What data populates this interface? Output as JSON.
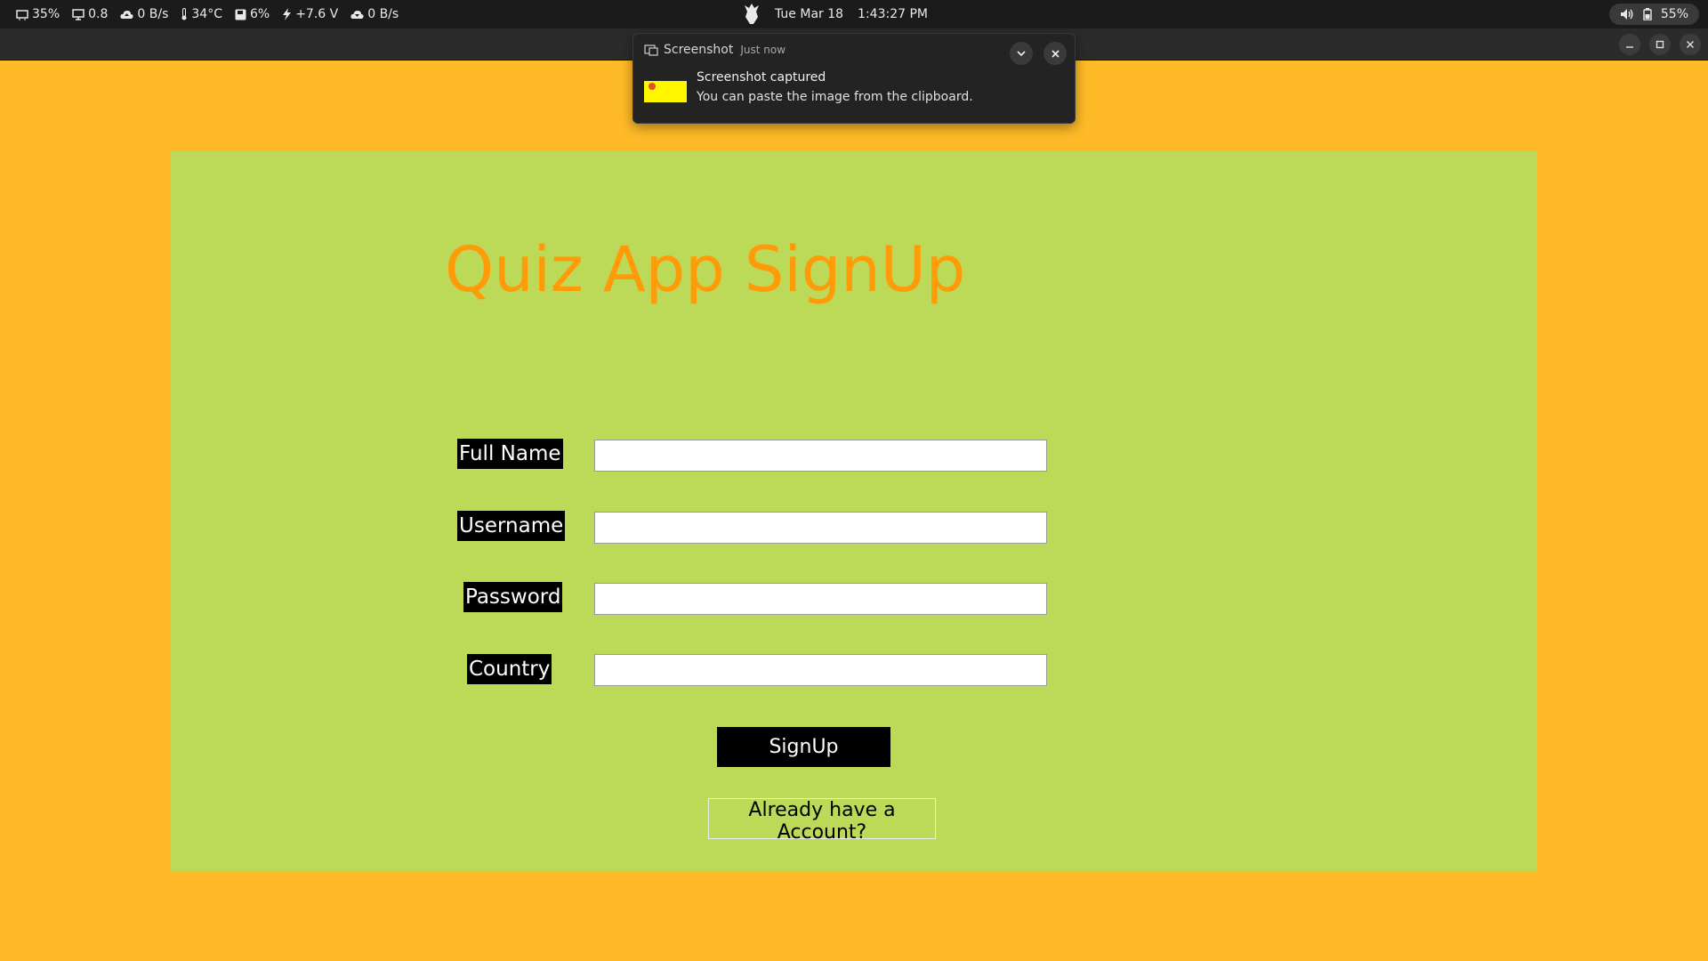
{
  "system_bar": {
    "stats": [
      {
        "icon": "cpu-icon",
        "value": "35%"
      },
      {
        "icon": "monitor-icon",
        "value": "0.8"
      },
      {
        "icon": "cloud-upload-icon",
        "value": "0 B/s"
      },
      {
        "icon": "thermometer-icon",
        "value": "34°C"
      },
      {
        "icon": "disk-icon",
        "value": "6%"
      },
      {
        "icon": "lightning-icon",
        "value": "+7.6 V"
      },
      {
        "icon": "cloud-download-icon",
        "value": "0 B/s"
      }
    ],
    "date": "Tue Mar 18",
    "time": "1:43:27 PM",
    "battery": "55%"
  },
  "notification": {
    "app": "Screenshot",
    "time": "Just now",
    "title": "Screenshot captured",
    "body": "You can paste the image from the clipboard."
  },
  "form": {
    "title": "Quiz App SignUp",
    "fields": [
      {
        "label": "Full Name",
        "value": "",
        "placeholder": ""
      },
      {
        "label": "Username",
        "value": "",
        "placeholder": ""
      },
      {
        "label": "Password",
        "value": "",
        "placeholder": ""
      },
      {
        "label": "Country",
        "value": "",
        "placeholder": ""
      }
    ],
    "signup_label": "SignUp",
    "login_link_label": "Already have a Account?"
  },
  "colors": {
    "background": "#FFBA27",
    "panel": "#BCD957",
    "title": "#FF9A09",
    "label_bg": "#000000",
    "button_bg": "#000000"
  }
}
